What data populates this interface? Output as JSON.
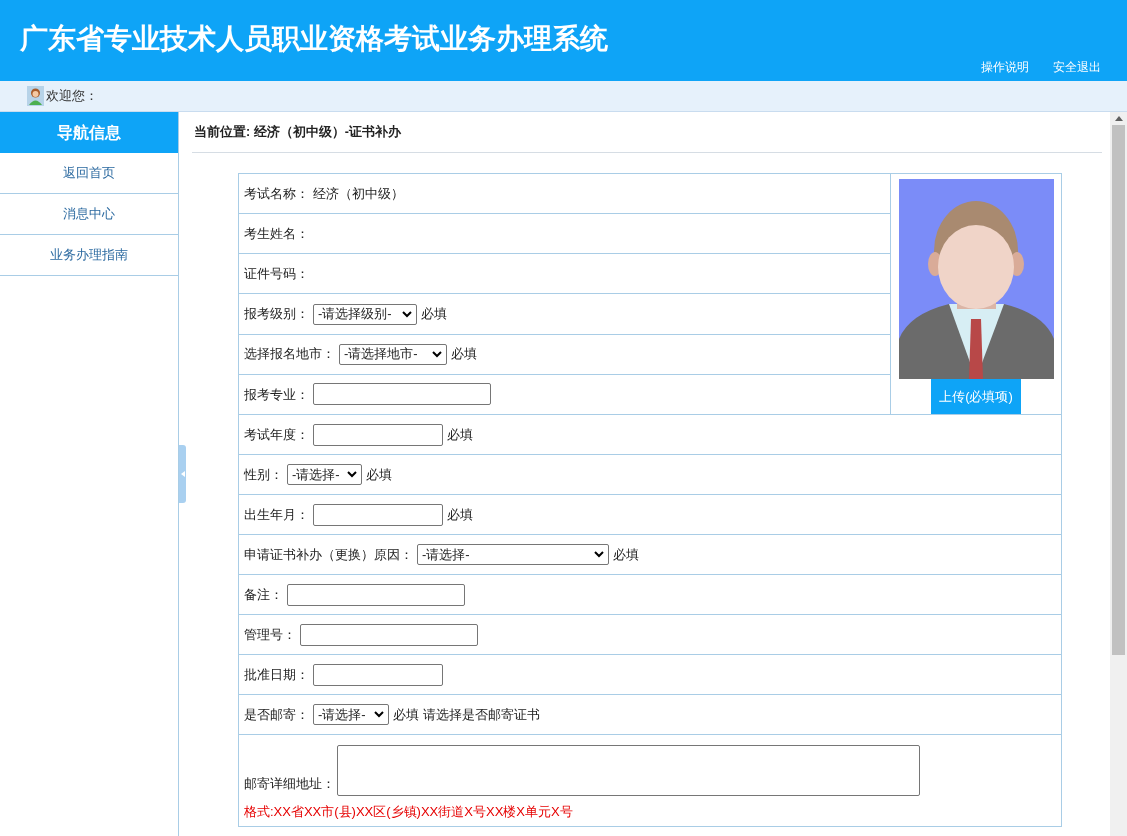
{
  "header": {
    "title": "广东省专业技术人员职业资格考试业务办理系统",
    "links": [
      "操作说明",
      "安全退出"
    ]
  },
  "welcome": {
    "label": "欢迎您："
  },
  "sidebar": {
    "title": "导航信息",
    "items": [
      "返回首页",
      "消息中心",
      "业务办理指南"
    ]
  },
  "breadcrumb": "当前位置: 经济（初中级）-证书补办",
  "photo": {
    "kind": "picture",
    "button": "上传(必填项)"
  },
  "form": [
    {
      "kind": "text",
      "label": "考试名称：",
      "value": "经济（初中级）"
    },
    {
      "kind": "text",
      "label": "考生姓名："
    },
    {
      "kind": "text",
      "label": "证件号码："
    },
    {
      "kind": "select",
      "label": "报考级别：",
      "value": "-请选择级别-",
      "notes": [
        "必填"
      ]
    },
    {
      "kind": "select",
      "label": "选择报名地市：",
      "value": "-请选择地市-",
      "notes": [
        "必填"
      ]
    },
    {
      "kind": "input",
      "label": "报考专业："
    },
    {
      "kind": "input",
      "label": "考试年度：",
      "notes": [
        "必填"
      ]
    },
    {
      "kind": "select",
      "label": "性别：",
      "value": "-请选择-",
      "notes": [
        "必填"
      ]
    },
    {
      "kind": "input",
      "label": "出生年月：",
      "notes": [
        "必填"
      ]
    },
    {
      "kind": "select",
      "label": "申请证书补办（更换）原因：",
      "value": "-请选择-",
      "notes": [
        "必填"
      ]
    },
    {
      "kind": "input",
      "label": "备注："
    },
    {
      "kind": "input",
      "label": "管理号："
    },
    {
      "kind": "input",
      "label": "批准日期："
    },
    {
      "kind": "select",
      "label": "是否邮寄：",
      "value": "-请选择-",
      "notes": [
        "必填",
        "请选择是否邮寄证书"
      ]
    },
    {
      "kind": "textarea",
      "label": "邮寄详细地址：",
      "hint": "格式:XX省XX市(县)XX区(乡镇)XX街道X号XX楼X单元X号"
    }
  ]
}
